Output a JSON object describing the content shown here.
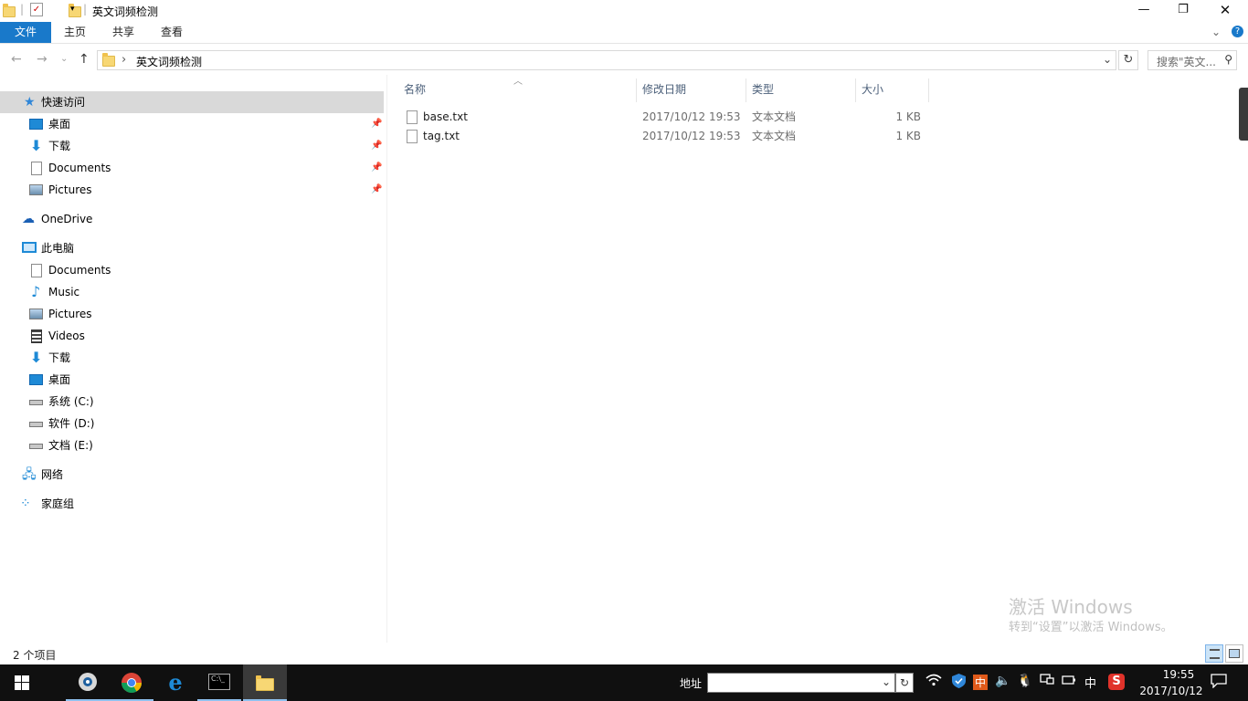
{
  "window": {
    "title": "英文词频检测",
    "minimize": "—",
    "maximize": "❐",
    "close": "✕"
  },
  "ribbon": {
    "tabs": [
      "文件",
      "主页",
      "共享",
      "查看"
    ],
    "collapse": "⌄",
    "help": "?"
  },
  "nav": {
    "back": "←",
    "forward": "→",
    "recent": "⌄",
    "up": "↑",
    "chevron": "›",
    "path": "英文词频检测",
    "refresh": "↻",
    "dropdown": "⌄",
    "search_placeholder": "搜索\"英文...",
    "search_icon": "⚲"
  },
  "sidebar": {
    "quick_access": "快速访问",
    "quick_items": [
      "桌面",
      "下载",
      "Documents",
      "Pictures"
    ],
    "onedrive": "OneDrive",
    "this_pc": "此电脑",
    "pc_items": [
      "Documents",
      "Music",
      "Pictures",
      "Videos",
      "下载",
      "桌面",
      "系统 (C:)",
      "软件 (D:)",
      "文档 (E:)"
    ],
    "network": "网络",
    "homegroup": "家庭组"
  },
  "columns": {
    "name": "名称",
    "date": "修改日期",
    "type": "类型",
    "size": "大小"
  },
  "files": [
    {
      "name": "base.txt",
      "date": "2017/10/12 19:53",
      "type": "文本文档",
      "size": "1 KB"
    },
    {
      "name": "tag.txt",
      "date": "2017/10/12 19:53",
      "type": "文本文档",
      "size": "1 KB"
    }
  ],
  "status": {
    "count": "2 个项目"
  },
  "watermark": {
    "line1": "激活 Windows",
    "line2": "转到“设置”以激活 Windows。"
  },
  "taskbar": {
    "address_label": "地址",
    "tray_ime1": "中",
    "tray_ime2": "中",
    "time": "19:55",
    "date": "2017/10/12"
  },
  "colors": {
    "file_tab": "#1979ca",
    "selected_nav": "#d9d9d9",
    "taskbar": "#101010",
    "accent": "#1e8ad6"
  }
}
